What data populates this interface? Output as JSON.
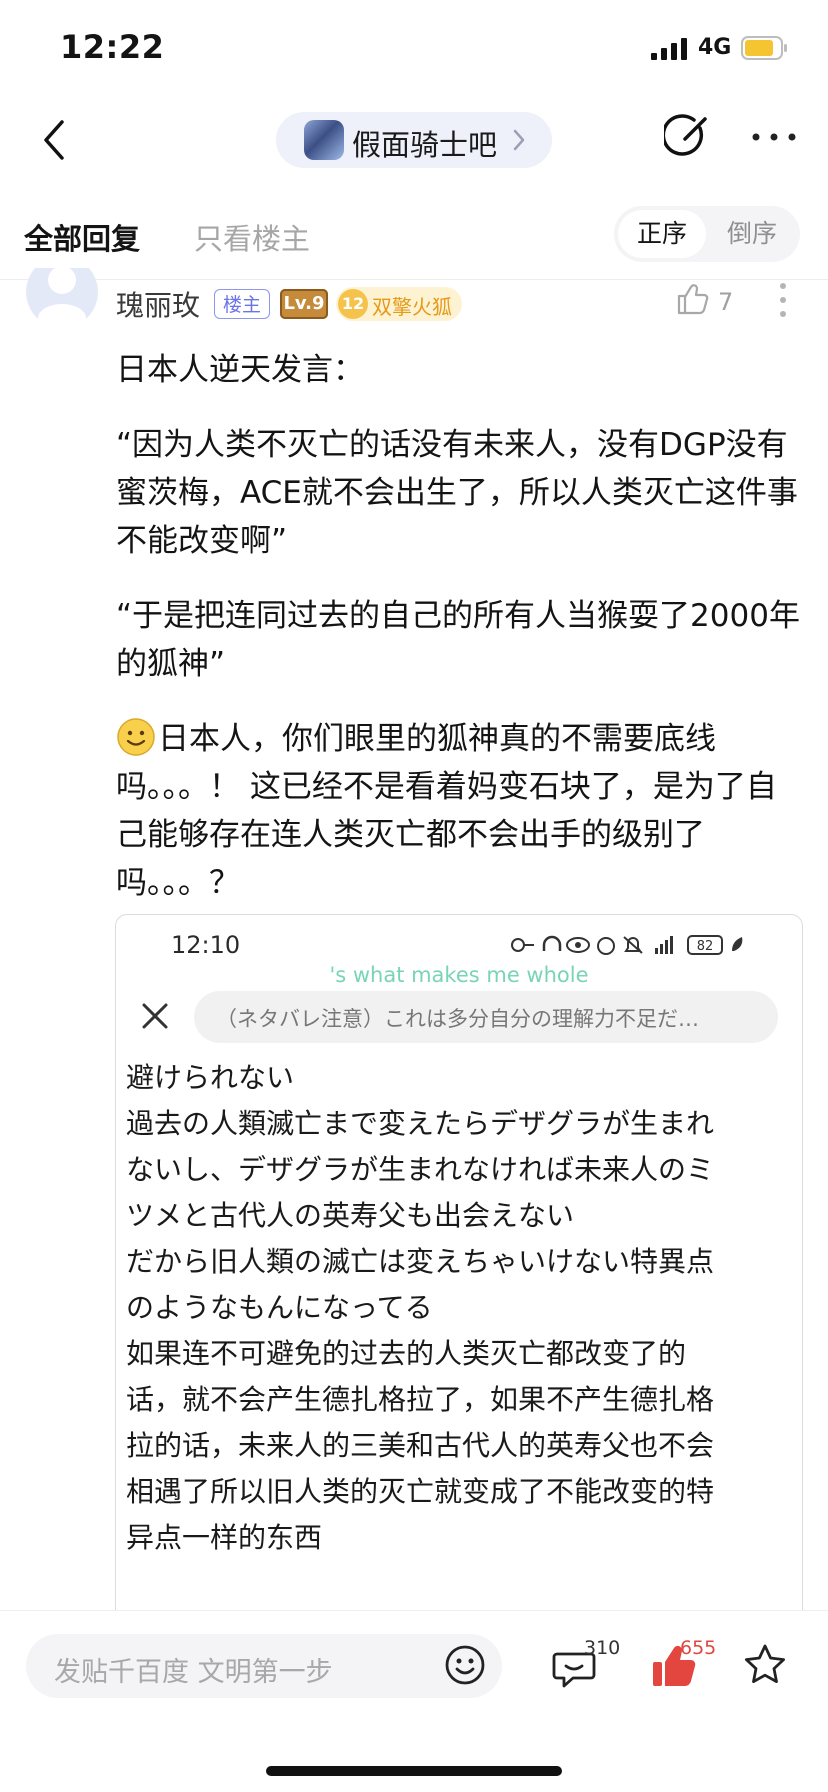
{
  "status_bar": {
    "time": "12:22",
    "network": "4G",
    "battery_color": "#f5c531"
  },
  "nav": {
    "forum_name": "假面骑士吧"
  },
  "tabs": {
    "all_replies": "全部回复",
    "only_op": "只看楼主",
    "order_asc": "正序",
    "order_desc": "倒序"
  },
  "post": {
    "username": "瑰丽玫",
    "op_badge": "楼主",
    "level": "Lv.9",
    "rank_number": "12",
    "rank_title": "双擎火狐",
    "likes": "7",
    "paragraphs": [
      "日本人逆天发言：",
      "“因为人类不灭亡的话没有未来人，没有DGP没有蜜茨梅，ACE就不会出生了，所以人类灭亡这件事不能改变啊”",
      "“于是把连同过去的自己的所有人当猴耍了2000年的狐神”",
      "日本人，你们眼里的狐神真的不需要底线吗。。。！ 这已经不是看着妈变石块了，是为了自己能够存在连人类灭亡都不会出手的级别了吗。。。？"
    ],
    "emoji": "smile-emoji"
  },
  "embedded_screenshot": {
    "time": "12:10",
    "battery": "82",
    "song_lyric": "'s what makes me whole",
    "search_text": "（ネタバレ注意）これは多分自分の理解力不足だ…",
    "lines": [
      "避けられない",
      "過去の人類滅亡まで変えたらデザグラが生まれ",
      "ないし、デザグラが生まれなければ未来人のミ",
      "ツメと古代人の英寿父も出会えない",
      "だから旧人類の滅亡は変えちゃいけない特異点",
      "のようなもんになってる",
      "如果连不可避免的过去的人类灭亡都改变了的",
      "话，就不会产生德扎格拉了，如果不产生德扎格",
      "拉的话，未来人的三美和古代人的英寿父也不会",
      "相遇了所以旧人类的灭亡就变成了不能改变的特",
      "异点一样的东西"
    ]
  },
  "bottom_bar": {
    "reply_placeholder": "发贴千百度 文明第一步",
    "comment_count": "310",
    "like_count": "655",
    "like_color": "#e2463f"
  }
}
